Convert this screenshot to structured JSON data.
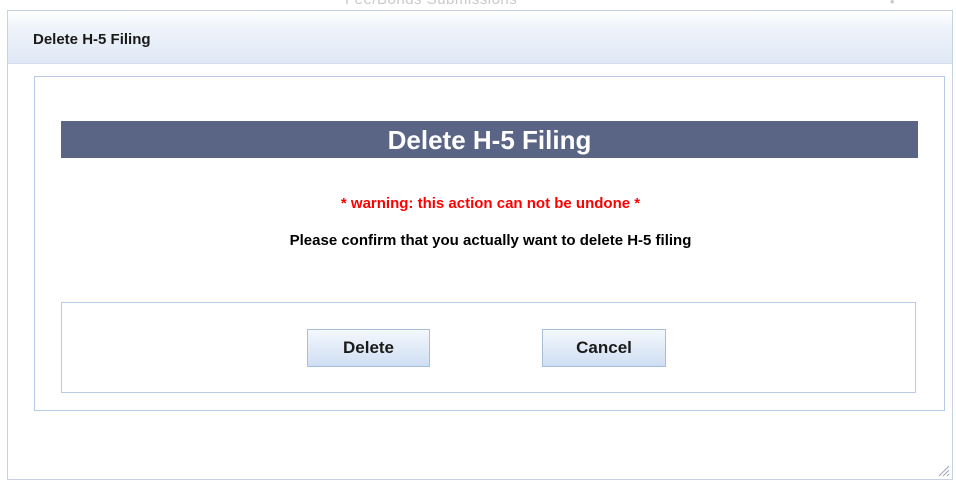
{
  "background": {
    "partial_text": "Fee/Bonds Submissions"
  },
  "dialog": {
    "title": "Delete H-5 Filing",
    "header": "Delete H-5 Filing",
    "warning": "* warning: this action can not be undone *",
    "message": "Please confirm that you actually want to delete H-5 filing",
    "buttons": {
      "delete_label": "Delete",
      "cancel_label": "Cancel"
    },
    "resize_icon": "resize-grip-icon"
  },
  "colors": {
    "header_bar": "#5a6585",
    "warning_text": "#ff0000",
    "border": "#b9cbe5",
    "titlebar": "#dfe8f5"
  }
}
